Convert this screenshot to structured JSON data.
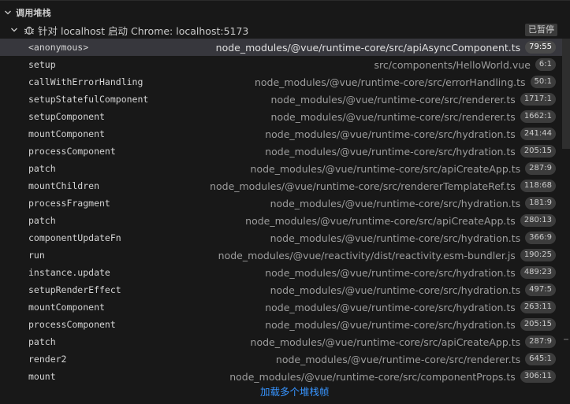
{
  "section": {
    "title": "调用堆栈",
    "expanded": true
  },
  "session": {
    "icon": "debug-session-icon",
    "label": "针对 localhost 启动 Chrome: localhost:5173",
    "status": "已暂停"
  },
  "frames": [
    {
      "name": "<anonymous>",
      "path": "node_modules/@vue/runtime-core/src/apiAsyncComponent.ts",
      "pos": "79:55",
      "selected": true
    },
    {
      "name": "setup",
      "path": "src/components/HelloWorld.vue",
      "pos": "6:1"
    },
    {
      "name": "callWithErrorHandling",
      "path": "node_modules/@vue/runtime-core/src/errorHandling.ts",
      "pos": "50:1"
    },
    {
      "name": "setupStatefulComponent",
      "path": "node_modules/@vue/runtime-core/src/renderer.ts",
      "pos": "1717:1"
    },
    {
      "name": "setupComponent",
      "path": "node_modules/@vue/runtime-core/src/renderer.ts",
      "pos": "1662:1"
    },
    {
      "name": "mountComponent",
      "path": "node_modules/@vue/runtime-core/src/hydration.ts",
      "pos": "241:44"
    },
    {
      "name": "processComponent",
      "path": "node_modules/@vue/runtime-core/src/hydration.ts",
      "pos": "205:15"
    },
    {
      "name": "patch",
      "path": "node_modules/@vue/runtime-core/src/apiCreateApp.ts",
      "pos": "287:9"
    },
    {
      "name": "mountChildren",
      "path": "node_modules/@vue/runtime-core/src/rendererTemplateRef.ts",
      "pos": "118:68"
    },
    {
      "name": "processFragment",
      "path": "node_modules/@vue/runtime-core/src/hydration.ts",
      "pos": "181:9"
    },
    {
      "name": "patch",
      "path": "node_modules/@vue/runtime-core/src/apiCreateApp.ts",
      "pos": "280:13"
    },
    {
      "name": "componentUpdateFn",
      "path": "node_modules/@vue/runtime-core/src/hydration.ts",
      "pos": "366:9"
    },
    {
      "name": "run",
      "path": "node_modules/@vue/reactivity/dist/reactivity.esm-bundler.js",
      "pos": "190:25"
    },
    {
      "name": "instance.update",
      "path": "node_modules/@vue/runtime-core/src/hydration.ts",
      "pos": "489:23"
    },
    {
      "name": "setupRenderEffect",
      "path": "node_modules/@vue/runtime-core/src/hydration.ts",
      "pos": "497:5"
    },
    {
      "name": "mountComponent",
      "path": "node_modules/@vue/runtime-core/src/hydration.ts",
      "pos": "263:11"
    },
    {
      "name": "processComponent",
      "path": "node_modules/@vue/runtime-core/src/hydration.ts",
      "pos": "205:15"
    },
    {
      "name": "patch",
      "path": "node_modules/@vue/runtime-core/src/apiCreateApp.ts",
      "pos": "287:9"
    },
    {
      "name": "render2",
      "path": "node_modules/@vue/runtime-core/src/renderer.ts",
      "pos": "645:1"
    },
    {
      "name": "mount",
      "path": "node_modules/@vue/runtime-core/src/componentProps.ts",
      "pos": "306:11"
    }
  ],
  "load_more_label": "加载多个堆栈帧",
  "colors": {
    "background": "#181818",
    "selected_row": "#37373d",
    "link": "#3794ff"
  }
}
